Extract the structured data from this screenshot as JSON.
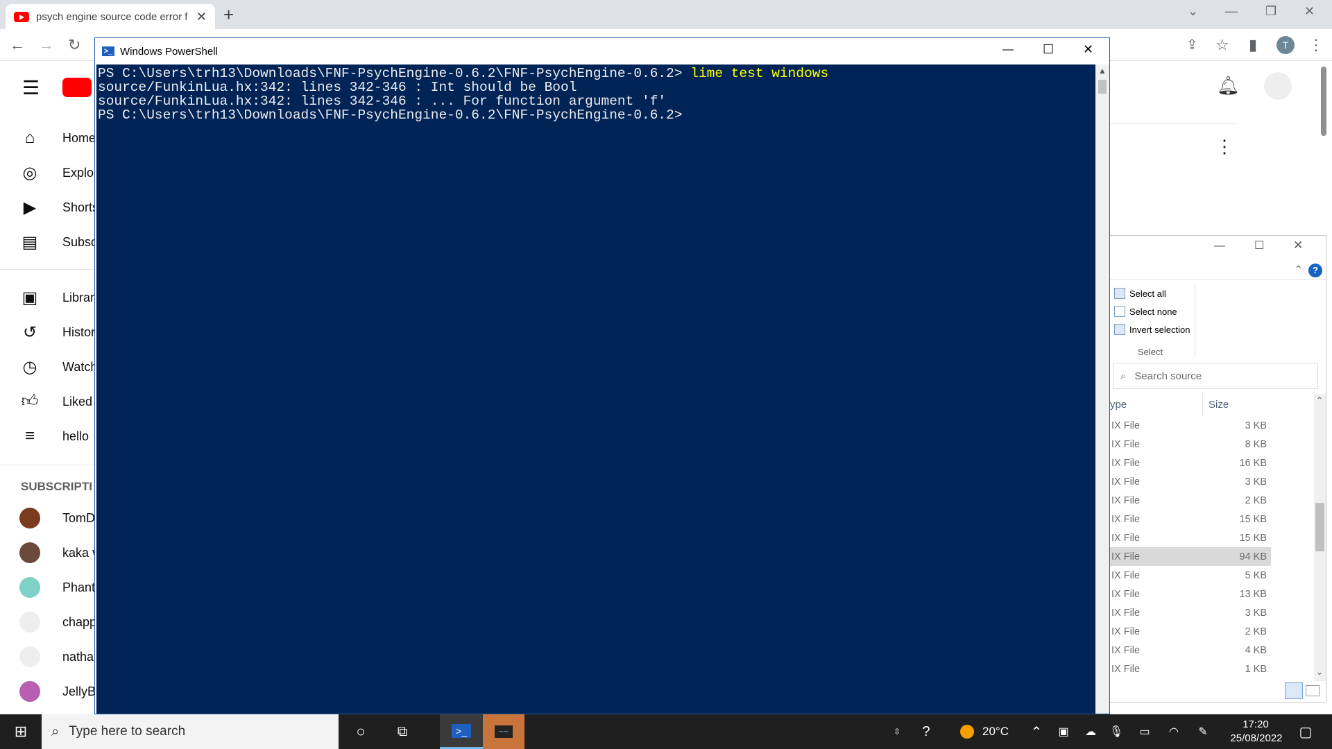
{
  "browser": {
    "tab_title": "psych engine source code error f",
    "tab_close": "✕",
    "new_tab": "+",
    "avatar_letter": "T",
    "minimize": "—",
    "restore": "❐",
    "close": "✕"
  },
  "youtube": {
    "nav": [
      {
        "label": "Home",
        "icon": "home-icon"
      },
      {
        "label": "Explor",
        "icon": "compass-icon"
      },
      {
        "label": "Shorts",
        "icon": "shorts-icon"
      },
      {
        "label": "Subsc",
        "icon": "subscriptions-icon"
      }
    ],
    "library": [
      {
        "label": "Library",
        "icon": "library-icon"
      },
      {
        "label": "Histor",
        "icon": "history-icon"
      },
      {
        "label": "Watch",
        "icon": "clock-icon"
      },
      {
        "label": "Liked",
        "icon": "thumbs-up-icon"
      },
      {
        "label": "hello",
        "icon": "playlist-icon"
      }
    ],
    "subscriptions_header": "SUBSCRIPTI",
    "subscriptions": [
      {
        "label": "TomD",
        "color": "#7a3b1f"
      },
      {
        "label": "kaka v",
        "color": "#6b4a3c"
      },
      {
        "label": "Phant",
        "color": "#7fd1c8"
      },
      {
        "label": "chapp",
        "color": "#eeeeee"
      },
      {
        "label": "nathar",
        "color": "#eeeeee"
      },
      {
        "label": "JellyB",
        "color": "#b85fb3"
      }
    ],
    "more_dots": "⋮"
  },
  "powershell": {
    "title": "Windows PowerShell",
    "lines": [
      {
        "prompt": "PS C:\\Users\\trh13\\Downloads\\FNF-PsychEngine-0.6.2\\FNF-PsychEngine-0.6.2> ",
        "cmd": "lime test windows"
      },
      {
        "prompt": "source/FunkinLua.hx:342: lines 342-346 : Int should be Bool",
        "cmd": ""
      },
      {
        "prompt": "source/FunkinLua.hx:342: lines 342-346 : ... For function argument 'f'",
        "cmd": ""
      },
      {
        "prompt": "PS C:\\Users\\trh13\\Downloads\\FNF-PsychEngine-0.6.2\\FNF-PsychEngine-0.6.2>",
        "cmd": ""
      }
    ]
  },
  "explorer": {
    "select_all": "Select all",
    "select_none": "Select none",
    "invert_selection": "Invert selection",
    "group_label": "Select",
    "search_placeholder": "Search source",
    "col_type": "ype",
    "col_size": "Size",
    "help": "?",
    "rows": [
      {
        "type": "IX File",
        "size": "3 KB"
      },
      {
        "type": "IX File",
        "size": "8 KB"
      },
      {
        "type": "IX File",
        "size": "16 KB"
      },
      {
        "type": "IX File",
        "size": "3 KB"
      },
      {
        "type": "IX File",
        "size": "2 KB"
      },
      {
        "type": "IX File",
        "size": "15 KB"
      },
      {
        "type": "IX File",
        "size": "15 KB"
      },
      {
        "type": "IX File",
        "size": "94 KB"
      },
      {
        "type": "IX File",
        "size": "5 KB"
      },
      {
        "type": "IX File",
        "size": "13 KB"
      },
      {
        "type": "IX File",
        "size": "3 KB"
      },
      {
        "type": "IX File",
        "size": "2 KB"
      },
      {
        "type": "IX File",
        "size": "4 KB"
      },
      {
        "type": "IX File",
        "size": "1 KB"
      }
    ],
    "selected_row": 7
  },
  "taskbar": {
    "search_placeholder": "Type here to search",
    "weather": "20°C",
    "time": "17:20",
    "date": "25/08/2022"
  }
}
